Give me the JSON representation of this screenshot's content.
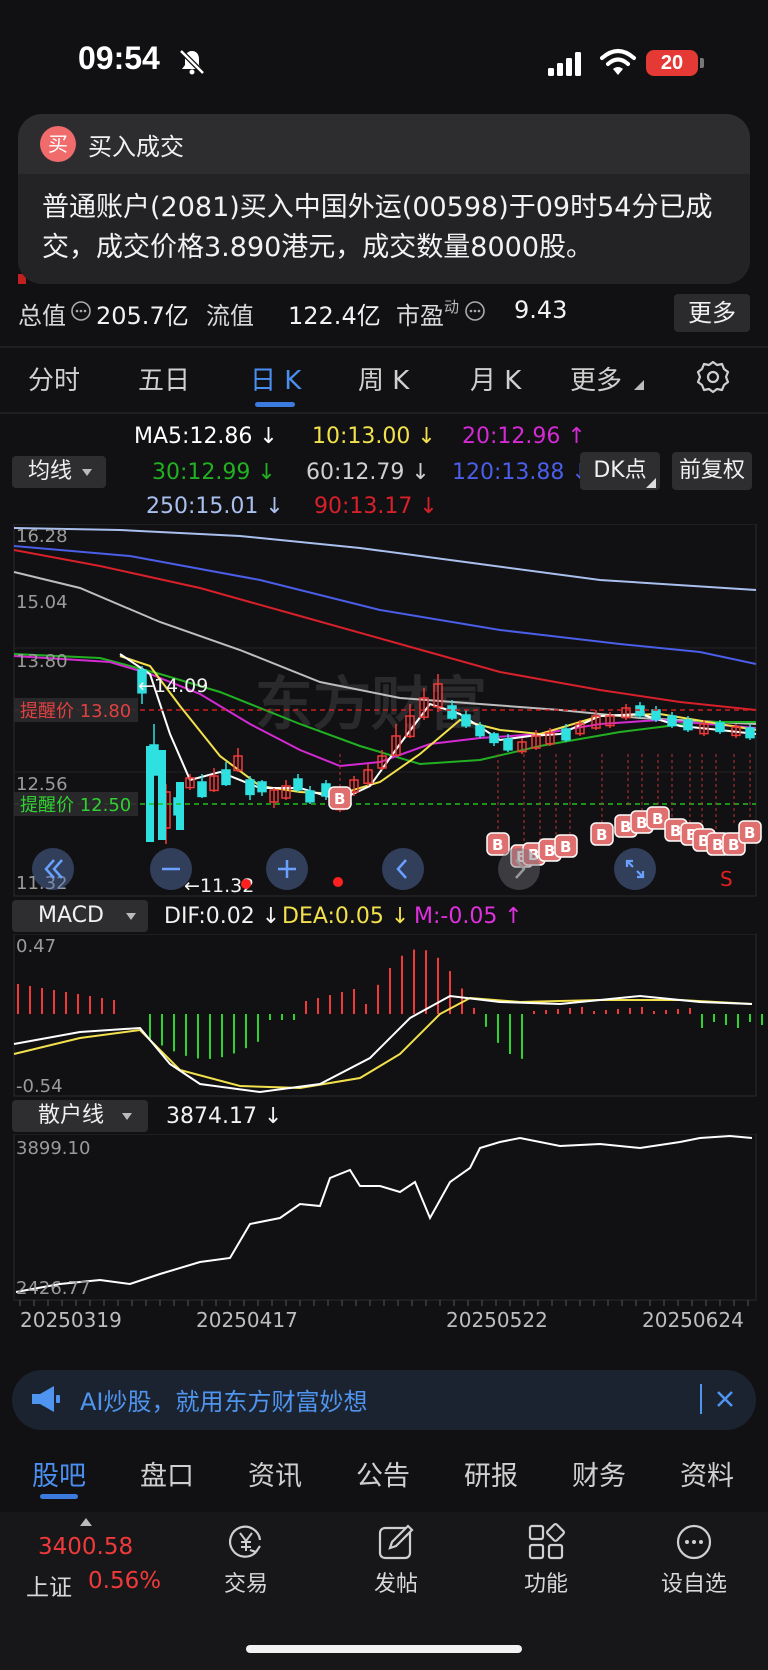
{
  "status": {
    "time": "09:54",
    "battery": "20"
  },
  "notification": {
    "icon_char": "买",
    "app": "买入成交",
    "line1": "普通账户(2081)买入中国外运(00598)于09时54分已成",
    "line2": "交，成交价格3.890港元，成交数量8000股。"
  },
  "info": {
    "total_label": "总值",
    "total_value": "205.7亿",
    "float_label": "流值",
    "float_value": "122.4亿",
    "pe_label": "市盈",
    "pe_sup": "动",
    "pe_value": "9.43",
    "more": "更多"
  },
  "chart_tabs": [
    {
      "label": "分时"
    },
    {
      "label": "五日"
    },
    {
      "label": "日 K"
    },
    {
      "label": "周 K"
    },
    {
      "label": "月 K"
    },
    {
      "label": "更多"
    }
  ],
  "ma_selector": "均线",
  "ma_legend": {
    "ma5": "MA5:12.86 ↓",
    "ma10": "10:13.00 ↓",
    "ma20": "20:12.96 ↑",
    "ma30": "30:12.99 ↓",
    "ma60": "60:12.79 ↓",
    "ma120": "120:13.88 ↓",
    "ma250": "250:15.01 ↓",
    "ma90": "90:13.17 ↓"
  },
  "dk_button": "DK点",
  "fuquan_button": "前复权",
  "colors": {
    "ma5": "#ffffff",
    "ma10": "#f2e14c",
    "ma20": "#d42ad4",
    "ma30": "#22b022",
    "ma60": "#bdbdbd",
    "ma120": "#4a5ee8",
    "ma250": "#a9c0ee",
    "ma90": "#d8202a",
    "up": "#f03a3a",
    "down": "#2ee0e0"
  },
  "kline": {
    "price_top": "16.28",
    "price_mid1": "15.04",
    "price_mid2": "13.80",
    "price_mid3": "12.56",
    "price_bottom": "11.32",
    "high_mark": "←14.09",
    "low_mark": "←11.32",
    "alert_high": "提醒价 13.80",
    "alert_low": "提醒价 12.50",
    "watermark": "东方财富",
    "buy_marker": "B",
    "sell_marker": "S"
  },
  "macd": {
    "selector": "MACD",
    "dif": "DIF:0.02 ↓",
    "dea": "DEA:0.05 ↓",
    "m": "M:-0.05 ↑",
    "top": "0.47",
    "bottom": "-0.54"
  },
  "retail": {
    "selector": "散户线",
    "value": "3874.17 ↓",
    "top": "3899.10",
    "bottom": "2426.77"
  },
  "dates": [
    "20250319",
    "20250417",
    "20250522",
    "20250624"
  ],
  "ai_banner": "AI炒股，就用东方财富妙想",
  "bottom_tabs": [
    {
      "label": "股吧"
    },
    {
      "label": "盘口"
    },
    {
      "label": "资讯"
    },
    {
      "label": "公告"
    },
    {
      "label": "研报"
    },
    {
      "label": "财务"
    },
    {
      "label": "资料"
    }
  ],
  "index": {
    "value": "3400.58",
    "name": "上证",
    "change": "0.56%"
  },
  "nav": [
    {
      "label": "交易"
    },
    {
      "label": "发帖"
    },
    {
      "label": "功能"
    },
    {
      "label": "设自选"
    }
  ]
}
